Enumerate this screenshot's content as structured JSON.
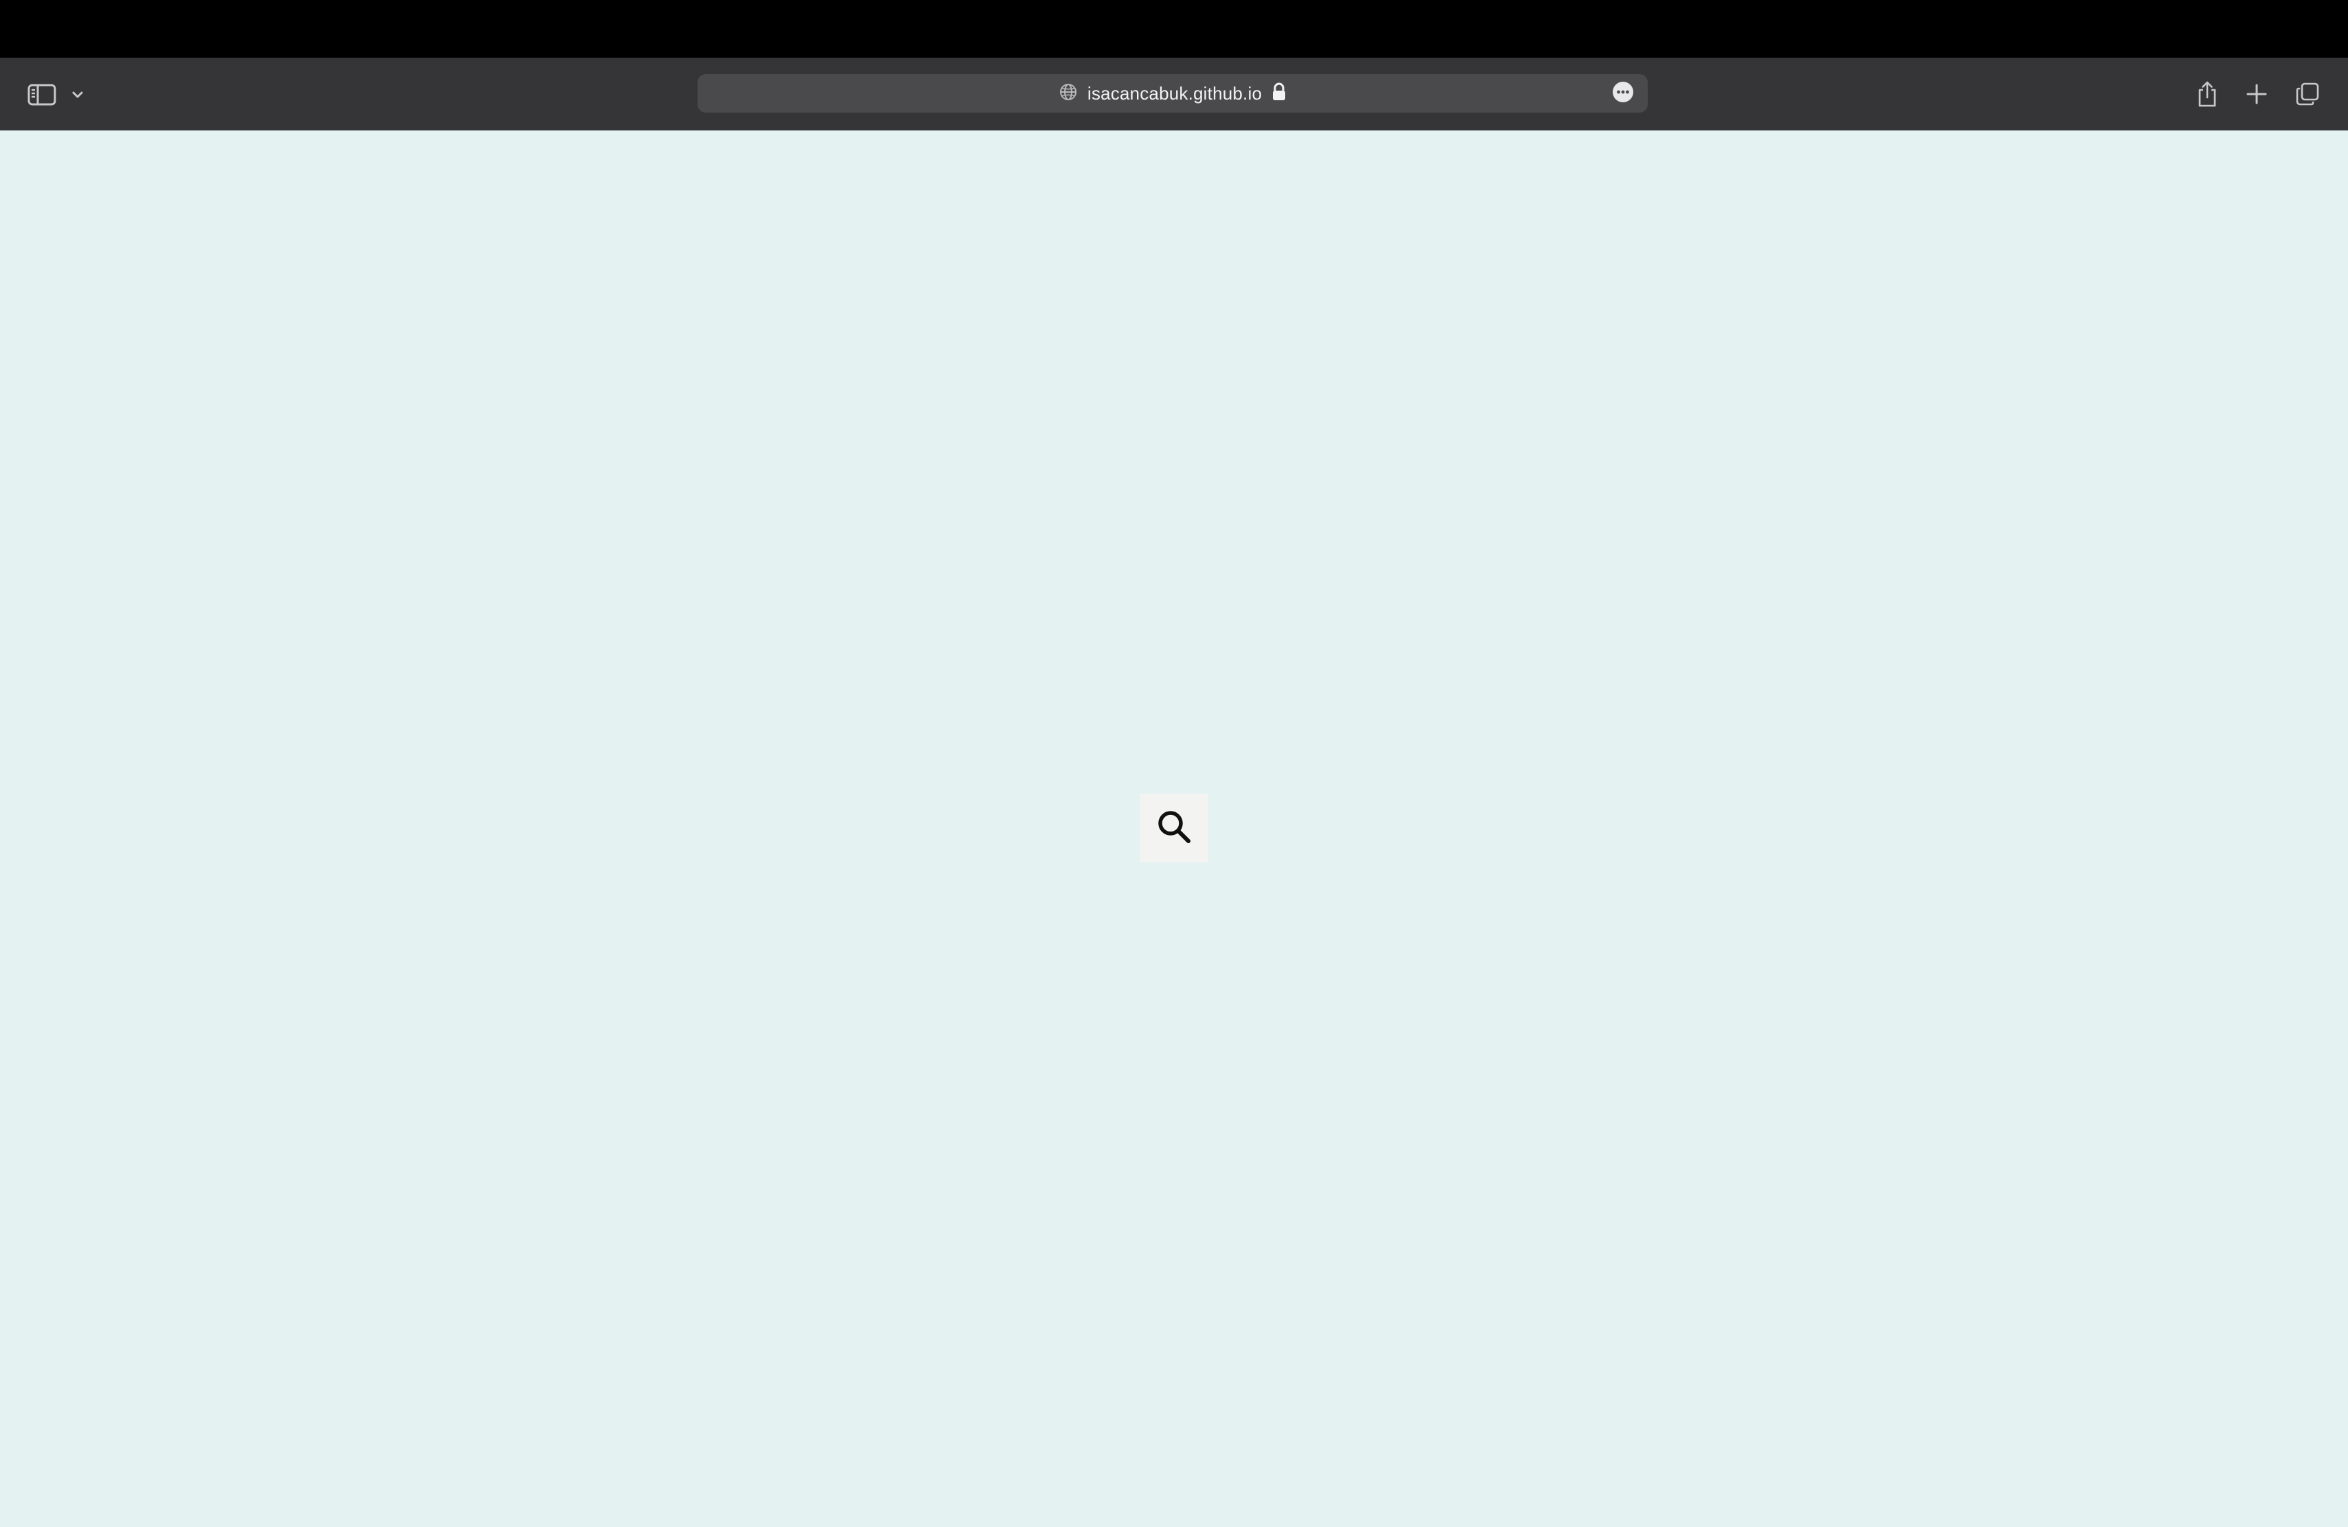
{
  "browser": {
    "url": "isacancabuk.github.io",
    "secure": true,
    "icons": {
      "sidebar_toggle": "sidebar-icon",
      "sidebar_menu": "chevron-down-icon",
      "site": "globe-icon",
      "lock": "lock-icon",
      "page_menu": "ellipsis-circle-icon",
      "share": "share-icon",
      "new_tab": "plus-icon",
      "tab_overview": "tabs-icon"
    },
    "colors": {
      "toolbar": "#353537",
      "address_bar": "#4a4a4c",
      "icon": "#c8c8ca"
    }
  },
  "page": {
    "background": "#e4f2f2",
    "search_button": {
      "icon": "search-icon",
      "background": "#f3f3f1"
    }
  }
}
